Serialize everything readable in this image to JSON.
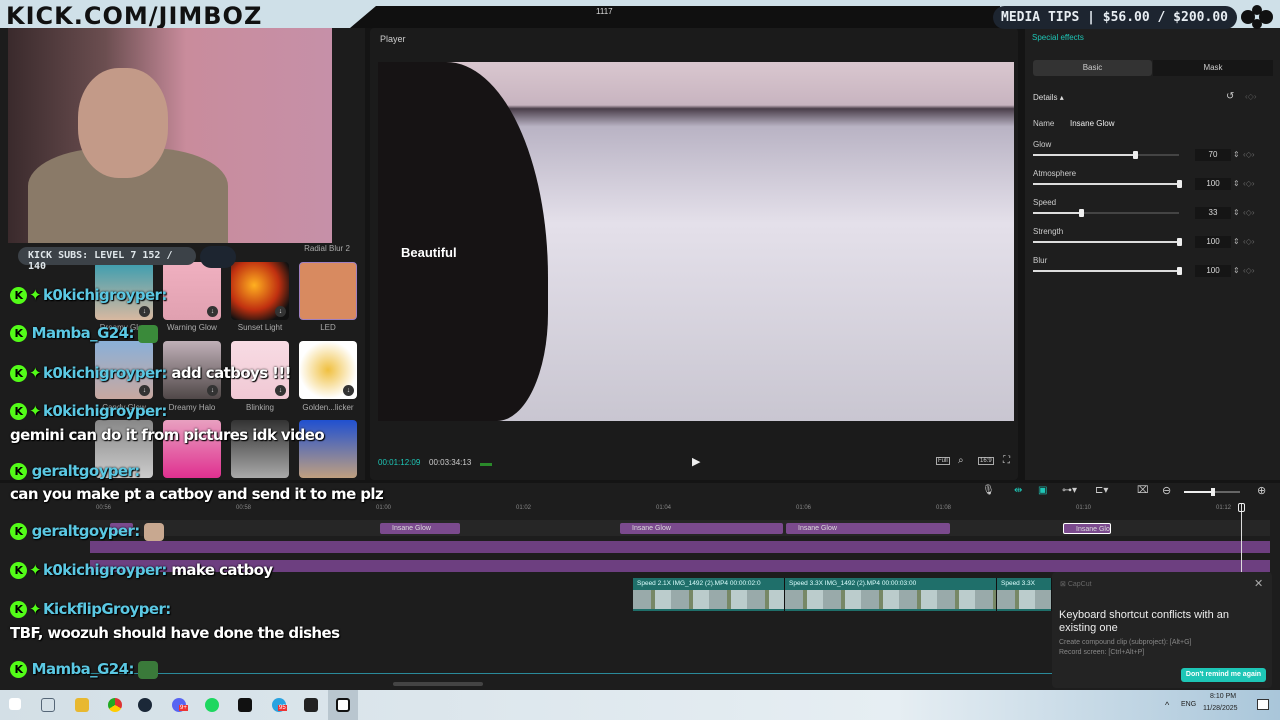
{
  "overlay": {
    "logo": "KICK.COM/JIMBOZ",
    "top_number": "1117",
    "subs_bar": "KICK SUBS: LEVEL 7 152 / 140",
    "tips_bar": "MEDIA TIPS | $56.00 / $200.00"
  },
  "effects": {
    "row1": [
      "",
      "",
      "",
      "Radial Blur 2"
    ],
    "row2": [
      "Dreamy Glow",
      "Warning Glow",
      "Sunset Light",
      "LED"
    ],
    "row3": [
      "Candy Glow",
      "Dreamy Halo",
      "Blinking",
      "Golden...licker"
    ]
  },
  "player": {
    "title": "Player",
    "current_time": "00:01:12:09",
    "total_time": "00:03:34:13",
    "buttons": {
      "full": "Full",
      "ratio": "16:9"
    },
    "overlay_text": "Beautiful"
  },
  "inspector": {
    "section": "Special effects",
    "tabs": [
      "Basic",
      "Mask"
    ],
    "active_tab": "Basic",
    "details_label": "Details",
    "name_label": "Name",
    "name_value": "Insane Glow",
    "params": [
      {
        "label": "Glow",
        "value": 70
      },
      {
        "label": "Atmosphere",
        "value": 100
      },
      {
        "label": "Speed",
        "value": 33
      },
      {
        "label": "Strength",
        "value": 100
      },
      {
        "label": "Blur",
        "value": 100
      }
    ]
  },
  "timeline": {
    "ruler": [
      "00:56",
      "00:58",
      "01:00",
      "01:02",
      "01:04",
      "01:06",
      "01:08",
      "01:10",
      "01:12"
    ],
    "effect_clips": [
      "Insane Glow",
      "Insane Glow",
      "Insane Glow",
      "Insane Glow"
    ],
    "video_clips": [
      "Speed 2.1X  IMG_1492 (2).MP4  00:00:02:0",
      "Speed 3.3X  IMG_1492 (2).MP4  00:00:03:00",
      "Speed 3.3X"
    ]
  },
  "notification": {
    "app": "CapCut",
    "title": "Keyboard shortcut conflicts with an existing one",
    "line1": "Create compound clip (subproject): [Alt+G]",
    "line2": "Record screen: [Ctrl+Alt+P]",
    "button": "Don't remind me again"
  },
  "chat": [
    {
      "user": "k0kichigroyper:",
      "msg": ""
    },
    {
      "user": "Mamba_G24:",
      "msg": ""
    },
    {
      "user": "k0kichigroyper:",
      "msg": "add catboys !!!"
    },
    {
      "user": "k0kichigroyper:",
      "msg": ""
    },
    {
      "user": "",
      "msg": "gemini can do it from pictures idk video"
    },
    {
      "user": "geraltgoyper:",
      "msg": ""
    },
    {
      "user": "",
      "msg": "can you make pt a catboy and send it to me plz"
    },
    {
      "user": "geraltgoyper:",
      "msg": ""
    },
    {
      "user": "k0kichigroyper:",
      "msg": "make catboy"
    },
    {
      "user": "KickflipGroyper:",
      "msg": ""
    },
    {
      "user": "",
      "msg": "TBF, woozuh should have done the dishes"
    },
    {
      "user": "Mamba_G24:",
      "msg": ""
    }
  ],
  "taskbar": {
    "lang": "ENG",
    "time": "8:10 PM",
    "date": "11/28/2025",
    "discord_badge": "9+",
    "telegram_badge": "95"
  },
  "colors": {
    "accent": "#1ec6b6",
    "clip_purple": "#7b4a8e",
    "kick_green": "#53fc18"
  }
}
